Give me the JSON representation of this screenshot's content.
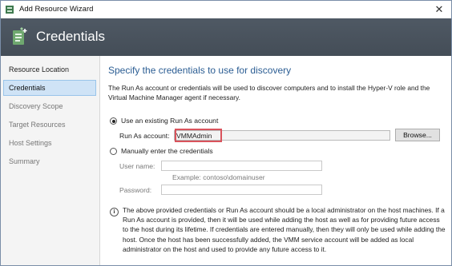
{
  "window": {
    "title": "Add Resource Wizard",
    "close_glyph": "✕"
  },
  "banner": {
    "heading": "Credentials"
  },
  "sidebar": {
    "items": [
      {
        "label": "Resource Location",
        "state": "done"
      },
      {
        "label": "Credentials",
        "state": "active"
      },
      {
        "label": "Discovery Scope",
        "state": "pending"
      },
      {
        "label": "Target Resources",
        "state": "pending"
      },
      {
        "label": "Host Settings",
        "state": "pending"
      },
      {
        "label": "Summary",
        "state": "pending"
      }
    ]
  },
  "main": {
    "heading": "Specify the credentials to use for discovery",
    "description": "The Run As account or credentials will be used to discover computers and to install the Hyper-V role and the Virtual Machine Manager agent if necessary.",
    "option_existing": {
      "label": "Use an existing Run As account",
      "selected": true
    },
    "run_as": {
      "label": "Run As account:",
      "value": "VMMAdmin",
      "browse_label": "Browse..."
    },
    "option_manual": {
      "label": "Manually enter the credentials",
      "selected": false
    },
    "user_name": {
      "label": "User name:",
      "value": "",
      "example": "Example: contoso\\domainuser"
    },
    "password": {
      "label": "Password:",
      "value": ""
    },
    "info_glyph": "i",
    "note": "The above provided credentials or Run As account should be a local administrator on the host machines. If a Run As account is provided, then it will be used while adding the host as well as for providing future access to the host during its lifetime. If credentials are entered manually, then they will only be used while adding the host. Once the host has been successfully added, the VMM service account will be added as local administrator on the host and used to provide any future access to it."
  },
  "colors": {
    "banner": "#4a535e",
    "heading": "#2b5d93",
    "active_nav": "#cfe3f6",
    "highlight": "#d9535c"
  }
}
